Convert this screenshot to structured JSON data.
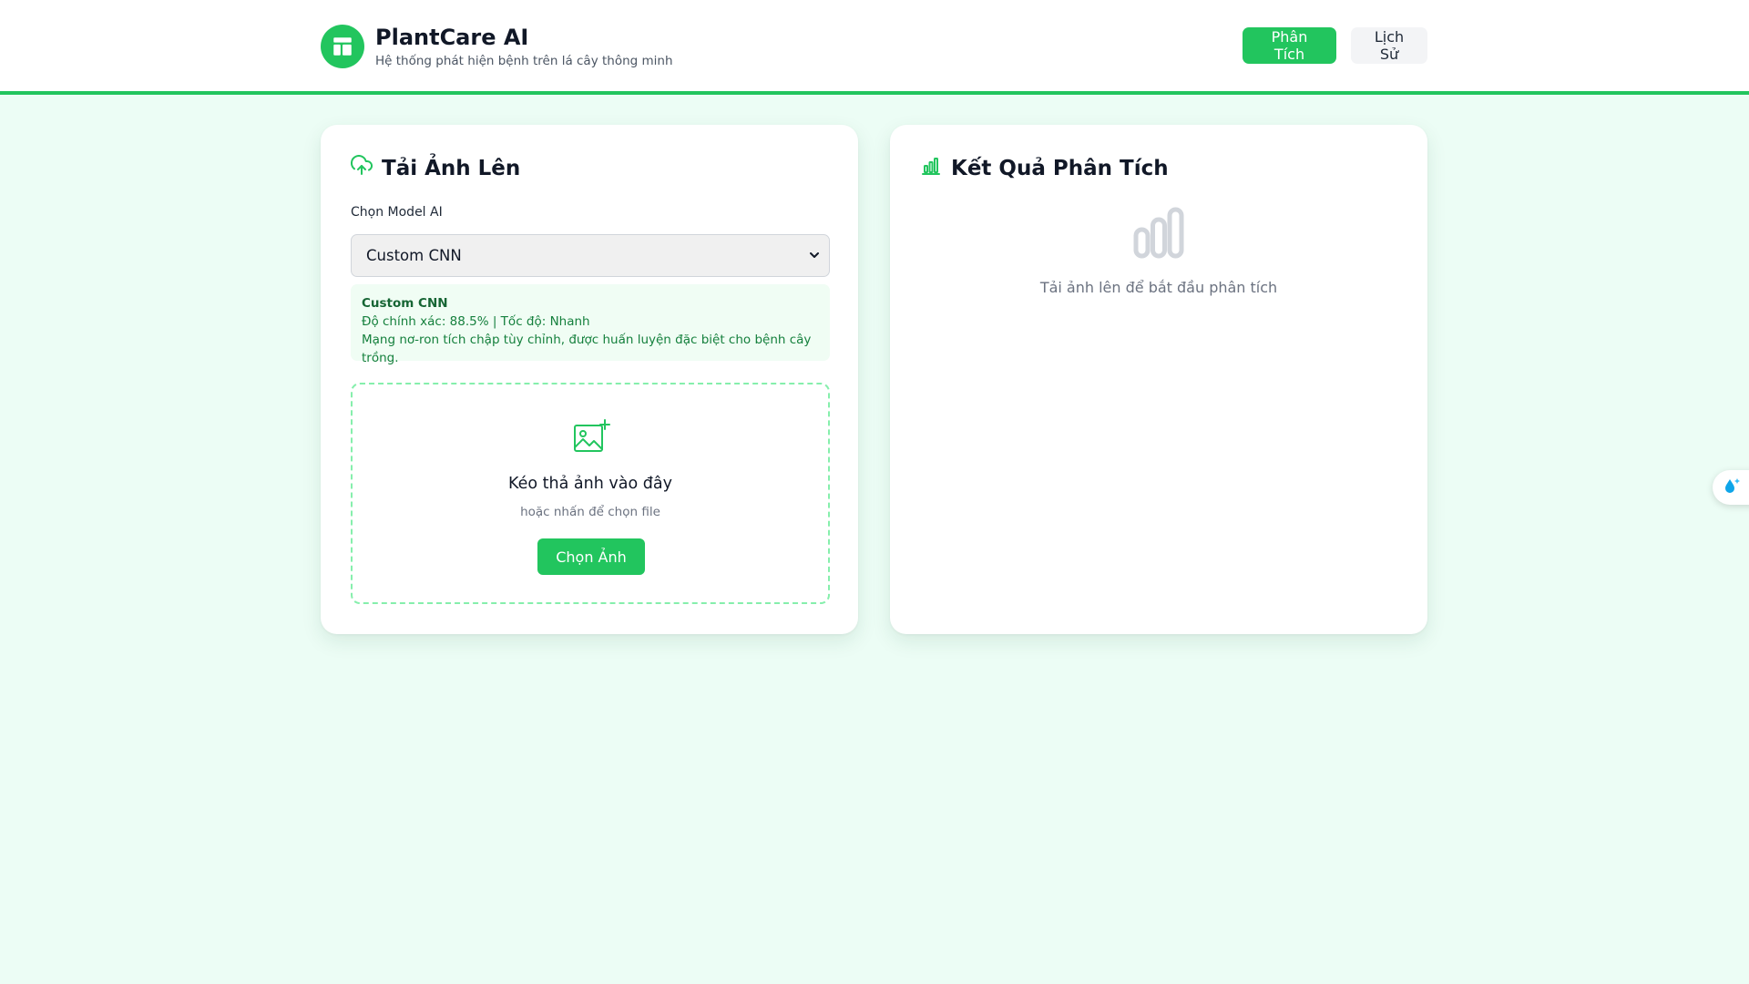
{
  "header": {
    "app_title": "PlantCare AI",
    "app_subtitle": "Hệ thống phát hiện bệnh trên lá cây thông minh",
    "logo_icon": "layout-icon",
    "nav": {
      "analyze_label": "Phân Tích",
      "history_label": "Lịch Sử"
    }
  },
  "upload_panel": {
    "title": "Tải Ảnh Lên",
    "title_icon": "upload-cloud-icon",
    "model_label": "Chọn Model AI",
    "selected_model": "Custom CNN",
    "model_info": {
      "name": "Custom CNN",
      "stats": "Độ chính xác: 88.5% | Tốc độ: Nhanh",
      "description": "Mạng nơ-ron tích chập tùy chỉnh, được huấn luyện đặc biệt cho bệnh cây trồng."
    },
    "dropzone": {
      "icon": "image-plus-icon",
      "title": "Kéo thả ảnh vào đây",
      "subtitle": "hoặc nhấn để chọn file",
      "button_label": "Chọn Ảnh"
    }
  },
  "result_panel": {
    "title": "Kết Quả Phân Tích",
    "title_icon": "bar-chart-icon",
    "empty_icon": "bar-chart-icon",
    "empty_text": "Tải ảnh lên để bắt đầu phân tích"
  },
  "colors": {
    "accent": "#22c55e",
    "background": "#ecfdf5",
    "info_bg": "#f0fdf4",
    "info_text": "#15803d"
  }
}
